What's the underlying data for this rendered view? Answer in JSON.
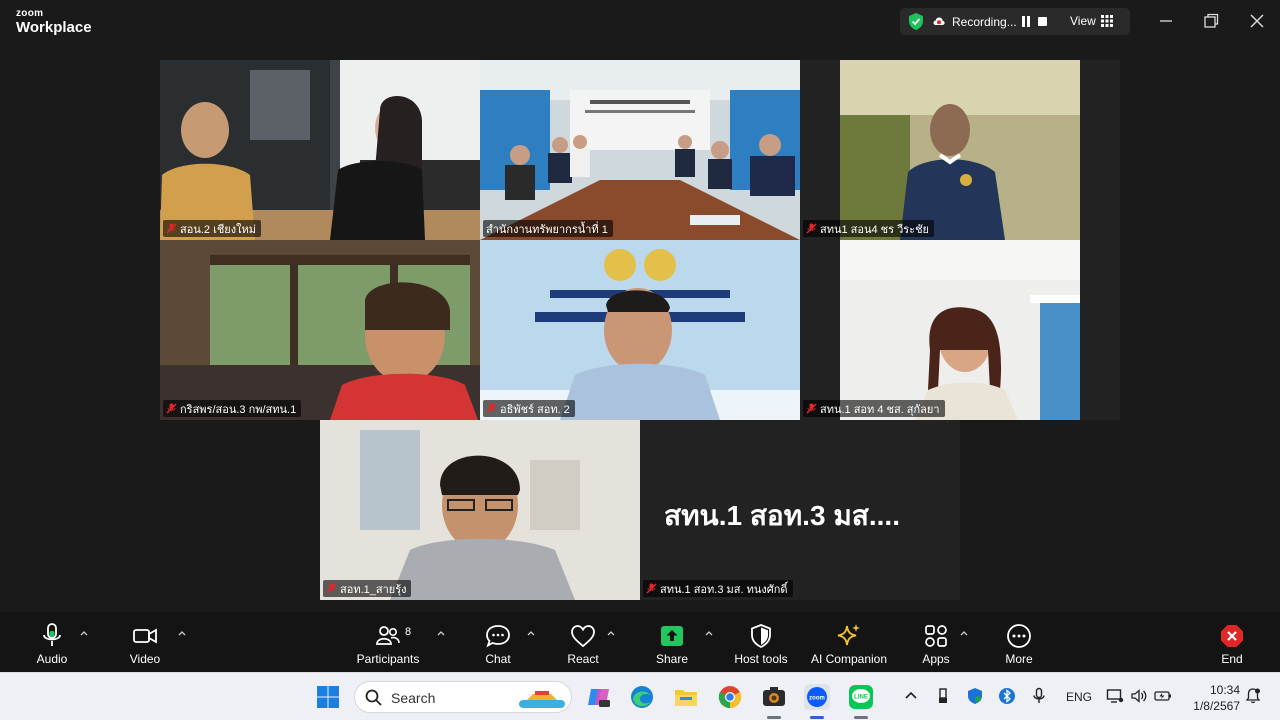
{
  "titlebar": {
    "brand_top": "zoom",
    "brand_bottom": "Workplace",
    "recording_label": "Recording...",
    "view_label": "View"
  },
  "tiles": [
    {
      "name": "สอน.2 เชียงใหม่"
    },
    {
      "name": "สำนักงานทรัพยากรน้ำที่ 1"
    },
    {
      "name": "สทน1 สอน4 ชร วีระชัย"
    },
    {
      "name": "กริสพร/สอน.3 กพ/สทน.1"
    },
    {
      "name": "อธิพัชร์ สอท. 2"
    },
    {
      "name": "สทน.1 สอท 4 ชส. สุกัลยา"
    },
    {
      "name": "สอท.1_สายรุ้ง"
    },
    {
      "name": "สทน.1 สอท.3 มส. ทนงศักดิ์",
      "display_name": "สทน.1 สอท.3 มส...."
    }
  ],
  "toolbar": {
    "audio": "Audio",
    "video": "Video",
    "participants": "Participants",
    "participants_count": "8",
    "chat": "Chat",
    "react": "React",
    "share": "Share",
    "host_tools": "Host tools",
    "ai_companion": "AI Companion",
    "apps": "Apps",
    "more": "More",
    "end": "End"
  },
  "taskbar": {
    "search_label": "Search",
    "language": "ENG",
    "time": "10:34",
    "date": "1/8/2567"
  },
  "colors": {
    "active_speaker": "#2ee36a",
    "share_green": "#22c55e",
    "end_red": "#e02828",
    "mute_red": "#e02828"
  }
}
